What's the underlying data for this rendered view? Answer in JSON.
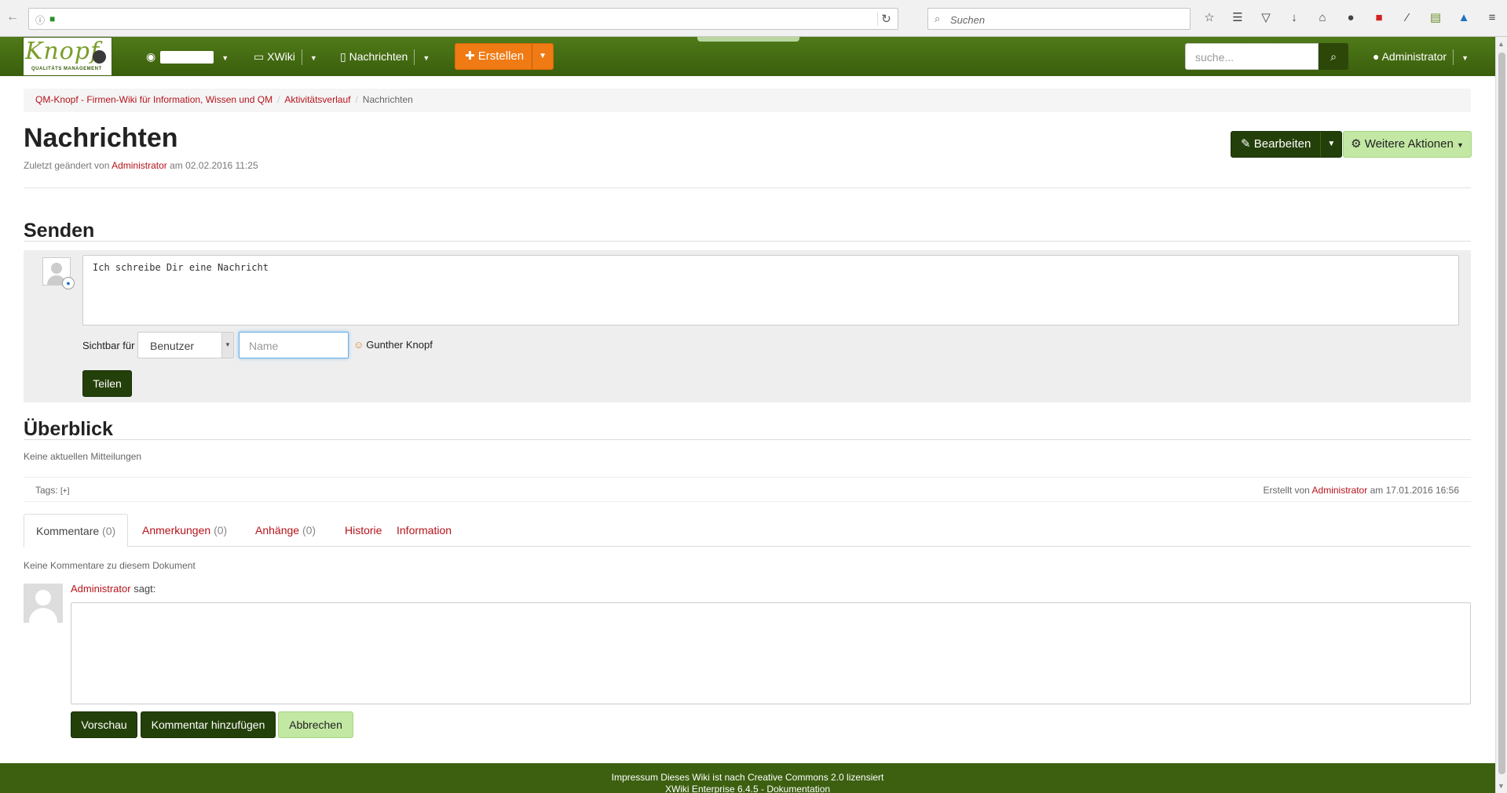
{
  "browser": {
    "search_placeholder": "Suchen",
    "toolbar_icons": [
      "star-icon",
      "reader-icon",
      "pocket-icon",
      "download-icon",
      "home-icon",
      "chat-icon",
      "pdf-icon",
      "wand-icon",
      "printer-icon",
      "extension-icon",
      "menu-icon"
    ]
  },
  "navbar": {
    "logo_text": "Knopf",
    "logo_sub": "QUALITÄTS MANAGEMENT",
    "space_label": "XWiki",
    "page_label": "Nachrichten",
    "create_label": "Erstellen",
    "search_placeholder": "suche...",
    "user_label": "Administrator"
  },
  "breadcrumb": {
    "items": [
      "QM-Knopf - Firmen-Wiki für Information, Wissen und QM",
      "Aktivitätsverlauf"
    ],
    "current": "Nachrichten"
  },
  "page": {
    "title": "Nachrichten",
    "last_modified_prefix": "Zuletzt geändert von",
    "last_modified_user": "Administrator",
    "last_modified_suffix": "am 02.02.2016 11:25",
    "edit_label": "Bearbeiten",
    "more_actions_label": "Weitere Aktionen"
  },
  "send": {
    "heading": "Senden",
    "message_value": "Ich schreibe Dir eine Nachricht",
    "visible_for_label": "Sichtbar für",
    "visibility_selected": "Benutzer",
    "name_placeholder": "Name",
    "recipient": "Gunther Knopf",
    "share_label": "Teilen"
  },
  "overview": {
    "heading": "Überblick",
    "empty_text": "Keine aktuellen Mitteilungen"
  },
  "tags": {
    "label": "Tags:",
    "add": "[+]",
    "created_prefix": "Erstellt von",
    "created_user": "Administrator",
    "created_suffix": "am 17.01.2016 16:56"
  },
  "tabs": [
    {
      "label": "Kommentare",
      "count": "(0)"
    },
    {
      "label": "Anmerkungen",
      "count": "(0)"
    },
    {
      "label": "Anhänge",
      "count": "(0)"
    },
    {
      "label": "Historie",
      "count": ""
    },
    {
      "label": "Information",
      "count": ""
    }
  ],
  "comments": {
    "empty_text": "Keine Kommentare zu diesem Dokument",
    "author": "Administrator",
    "says": "sagt:",
    "preview_label": "Vorschau",
    "add_label": "Kommentar hinzufügen",
    "cancel_label": "Abbrechen"
  },
  "footer": {
    "line1_link": "Impressum",
    "line1_text": "Dieses Wiki ist nach Creative Commons 2.0 lizensiert",
    "line2_text": "XWiki Enterprise 6.4.5 -",
    "line2_link": "Dokumentation"
  }
}
